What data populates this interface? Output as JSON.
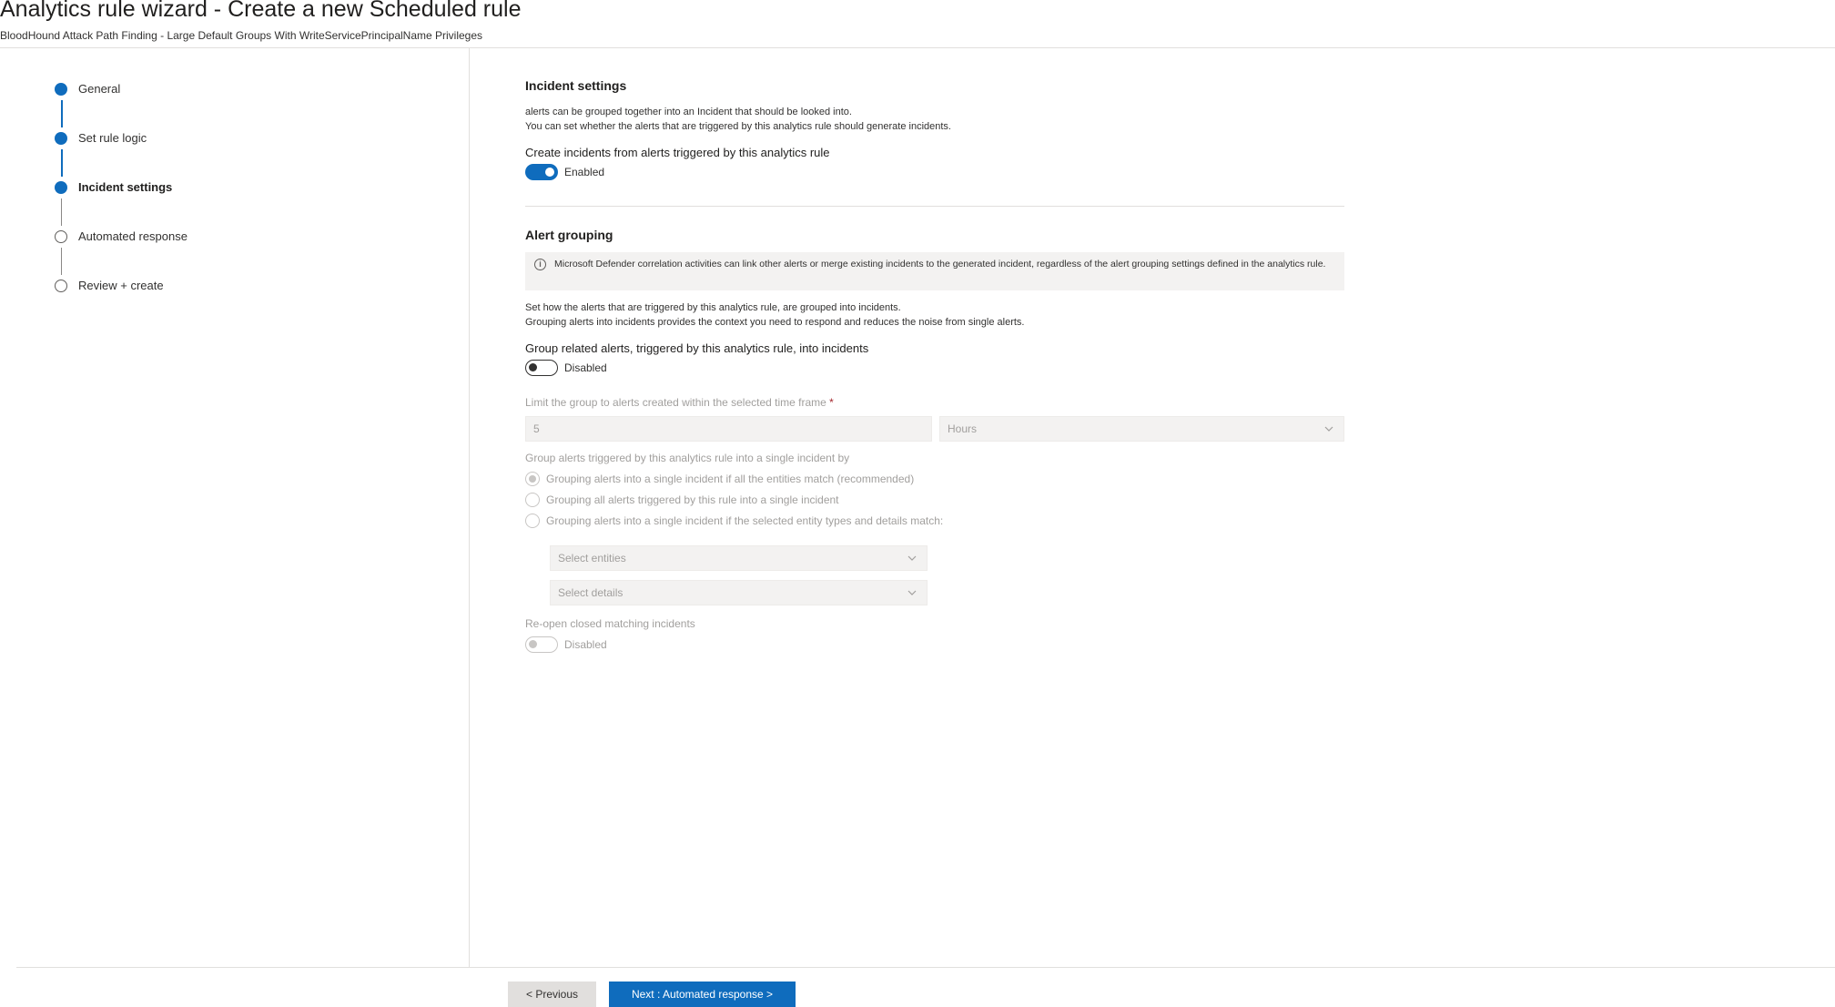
{
  "header": {
    "title": "Analytics rule wizard - Create a new Scheduled rule",
    "subtitle": "BloodHound Attack Path Finding - Large Default Groups With WriteServicePrincipalName Privileges"
  },
  "steps": [
    {
      "label": "General",
      "state": "done"
    },
    {
      "label": "Set rule logic",
      "state": "done"
    },
    {
      "label": "Incident settings",
      "state": "current"
    },
    {
      "label": "Automated response",
      "state": "todo"
    },
    {
      "label": "Review + create",
      "state": "todo"
    }
  ],
  "incident_settings": {
    "heading": "Incident settings",
    "desc_line1": "alerts can be grouped together into an Incident that should be looked into.",
    "desc_line2": "You can set whether the alerts that are triggered by this analytics rule should generate incidents.",
    "create_label": "Create incidents from alerts triggered by this analytics rule",
    "create_toggle_text": "Enabled"
  },
  "alert_grouping": {
    "heading": "Alert grouping",
    "info_text": "Microsoft Defender correlation activities can link other alerts or merge existing incidents to the generated incident, regardless of the alert grouping settings defined in the analytics rule.",
    "desc_line1": "Set how the alerts that are triggered by this analytics rule, are grouped into incidents.",
    "desc_line2": "Grouping alerts into incidents provides the context you need to respond and reduces the noise from single alerts.",
    "group_label": "Group related alerts, triggered by this analytics rule, into incidents",
    "group_toggle_text": "Disabled",
    "limit_label": "Limit the group to alerts created within the selected time frame",
    "limit_required": "*",
    "limit_value": "5",
    "limit_unit": "Hours",
    "group_by_label": "Group alerts triggered by this analytics rule into a single incident by",
    "radio_options": [
      "Grouping alerts into a single incident if all the entities match (recommended)",
      "Grouping all alerts triggered by this rule into a single incident",
      "Grouping alerts into a single incident if the selected entity types and details match:"
    ],
    "select_entities_placeholder": "Select entities",
    "select_details_placeholder": "Select details",
    "reopen_label": "Re-open closed matching incidents",
    "reopen_toggle_text": "Disabled"
  },
  "footer": {
    "previous_label": "< Previous",
    "next_label": "Next : Automated response >"
  },
  "colors": {
    "accent": "#0f6cbd",
    "disabled_text": "#a19f9d",
    "info_bg": "#f3f2f1"
  }
}
